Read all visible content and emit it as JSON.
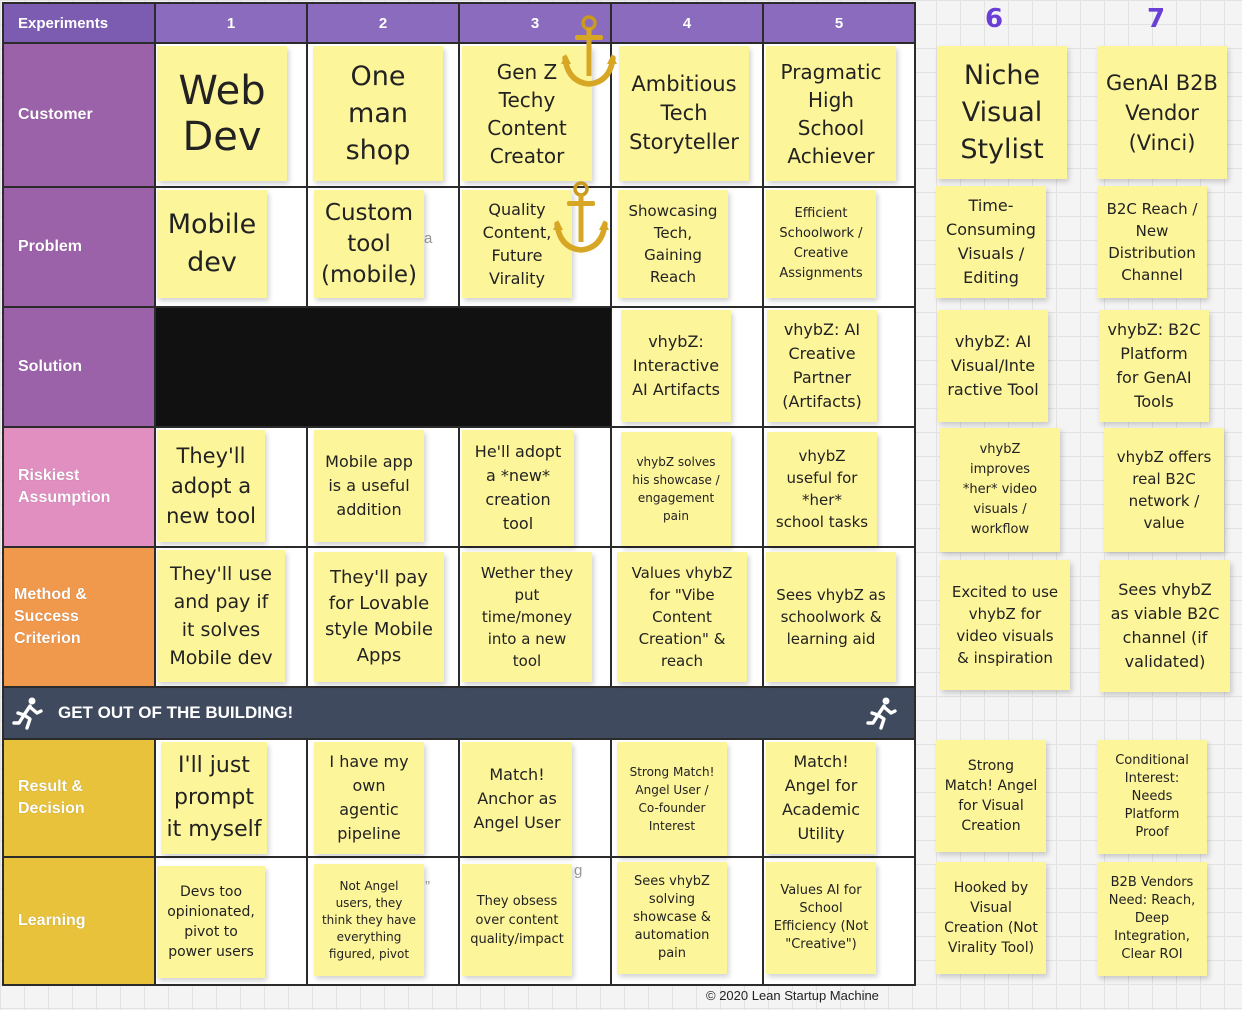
{
  "board": {
    "headers": {
      "experiments": "Experiments",
      "cols": [
        "1",
        "2",
        "3",
        "4",
        "5"
      ],
      "extra_cols": [
        "6",
        "7"
      ]
    },
    "rows": {
      "customer": "Customer",
      "problem": "Problem",
      "solution": "Solution",
      "riskiest": "Riskiest\nAssumption",
      "method": "Method &\nSuccess\nCriterion",
      "result": "Result &\nDecision",
      "learning": "Learning"
    },
    "banner": "GET OUT OF THE BUILDING!",
    "copyright": "© 2020 Lean Startup Machine",
    "colors": {
      "header_purple": "#8a6bbd",
      "customer": "#9b62a9",
      "riskiest": "#e08fc0",
      "method": "#f0984c",
      "result": "#e8c23a",
      "banner": "#3f4a5e",
      "sticky": "#fdf59a",
      "column_number": "#6a3fd6"
    }
  },
  "notes": {
    "customer": [
      "Web\nDev",
      "One\nman\nshop",
      "Gen Z\nTechy\nContent\nCreator",
      "Ambitious\nTech\nStoryteller",
      "Pragmatic\nHigh\nSchool\nAchiever",
      "Niche\nVisual\nStylist",
      "GenAI B2B\nVendor\n(Vinci)"
    ],
    "problem": [
      "Mobile\ndev",
      "Custom\ntool\n(mobile)",
      "Quality\nContent,\nFuture\nVirality",
      "Showcasing\nTech,\nGaining\nReach",
      "Efficient\nSchoolwork /\nCreative\nAssignments",
      "Time-\nConsuming\nVisuals /\nEditing",
      "B2C Reach /\nNew\nDistribution\nChannel"
    ],
    "solution": [
      "vhybZ:\nInteractive\nAI Artifacts",
      "vhybZ: AI\nCreative\nPartner\n(Artifacts)",
      "vhybZ: AI\nVisual/Inte\nractive Tool",
      "vhybZ: B2C\nPlatform\nfor GenAI\nTools"
    ],
    "riskiest": [
      "They'll\nadopt a\nnew tool",
      "Mobile app\nis a useful\naddition",
      "He'll adopt\na *new*\ncreation\ntool",
      "vhybZ solves\nhis showcase /\nengagement\npain",
      "vhybZ\nuseful for\n*her*\nschool tasks",
      "vhybZ\nimproves\n*her* video\nvisuals /\nworkflow",
      "vhybZ offers\nreal B2C\nnetwork /\nvalue"
    ],
    "method": [
      "They'll use\nand pay if\nit solves\nMobile dev",
      "They'll pay\nfor Lovable\nstyle Mobile\nApps",
      "Wether they\nput\ntime/money\ninto a new\ntool",
      "Values vhybZ\nfor \"Vibe\nContent\nCreation\" &\nreach",
      "Sees vhybZ as\nschoolwork &\nlearning aid",
      "Excited to use\nvhybZ for\nvideo visuals\n& inspiration",
      "Sees vhybZ\nas viable B2C\nchannel (if\nvalidated)"
    ],
    "result": [
      "I'll just\nprompt\nit myself",
      "I have my\nown\nagentic\npipeline",
      "Match!\nAnchor as\nAngel User",
      "Strong Match!\nAngel User /\nCo-founder\nInterest",
      "Match!\nAngel for\nAcademic\nUtility",
      "Strong\nMatch! Angel\nfor Visual\nCreation",
      "Conditional\nInterest:\nNeeds\nPlatform\nProof"
    ],
    "learning": [
      "Devs too\nopinionated,\npivot to\npower users",
      "Not Angel\nusers, they\nthink they have\neverything\nfigured, pivot",
      "They obsess\nover content\nquality/impact",
      "Sees vhybZ\nsolving\nshowcase &\nautomation\npain",
      "Values AI for\nSchool\nEfficiency (Not\n\"Creative\")",
      "Hooked by\nVisual\nCreation (Not\nVirality Tool)",
      "B2B Vendors\nNeed: Reach,\nDeep\nIntegration,\nClear ROI"
    ]
  },
  "icons": {
    "anchor_1": "anchor-icon",
    "anchor_2": "anchor-icon",
    "runner_left": "running-man-icon",
    "runner_right": "running-man-icon"
  }
}
